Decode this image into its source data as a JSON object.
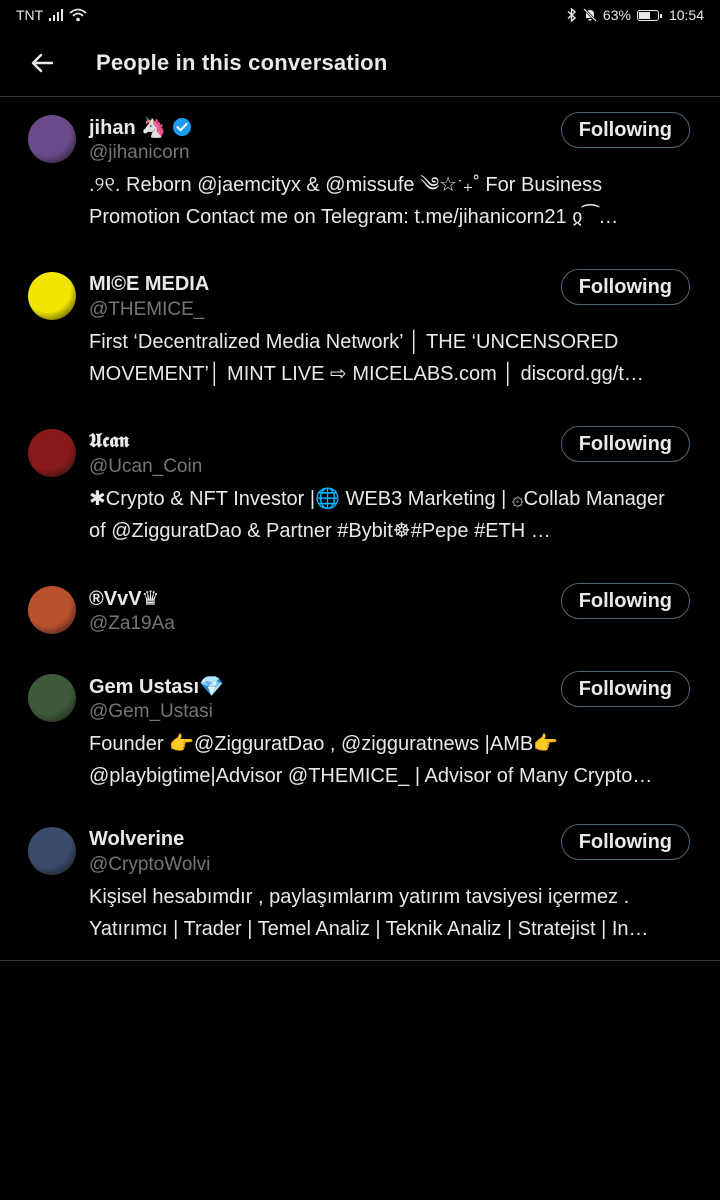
{
  "status_bar": {
    "carrier": "TNT",
    "battery": "63%",
    "battery_level": 0.63,
    "time": "10:54"
  },
  "header": {
    "title": "People in this conversation"
  },
  "people": [
    {
      "name": "jihan 🦄",
      "verified": true,
      "handle": "@jihanicorn",
      "bio": ".୨୧. Reborn @jaemcityx & @missufe ༄☆ˑ₊˚ For Business Promotion Contact me on Telegram: t.me/jihanicorn21 ჲ⁀…",
      "follow_label": "Following",
      "avatar_color": "#6b4a8a"
    },
    {
      "name": "MI©E MEDIA",
      "verified": false,
      "handle": "@THEMICE_",
      "bio": "First ‘Decentralized Media Network’ │ THE ‘UNCENSORED MOVEMENT’│ MINT LIVE ⇨ MICELABS.com │ discord.gg/t…",
      "follow_label": "Following",
      "avatar_color": "#f2e500"
    },
    {
      "name": "𝖀𝖈𝖆𝖓",
      "verified": false,
      "handle": "@Ucan_Coin",
      "bio": "✱Crypto & NFT Investor |🌐 WEB3 Marketing | ۞Collab Manager of @ZigguratDao & Partner #Bybit☸#Pepe #ETH …",
      "follow_label": "Following",
      "avatar_color": "#8a1a1a"
    },
    {
      "name": "®VvV♛",
      "verified": false,
      "handle": "@Za19Aa",
      "bio": "",
      "follow_label": "Following",
      "avatar_color": "#b8502e"
    },
    {
      "name": "Gem Ustası💎",
      "verified": false,
      "handle": "@Gem_Ustasi",
      "bio": "Founder 👉@ZigguratDao , @zigguratnews |AMB👉 @playbigtime|Advisor @THEMICE_ | Advisor of Many Crypto…",
      "follow_label": "Following",
      "avatar_color": "#3d5a3a"
    },
    {
      "name": "Wolverine",
      "verified": false,
      "handle": "@CryptoWolvi",
      "bio": "Kişisel hesabımdır , paylaşımlarım yatırım tavsiyesi içermez . Yatırımcı | Trader | Temel Analiz | Teknik Analiz | Stratejist | In…",
      "follow_label": "Following",
      "avatar_color": "#3a4a6a"
    }
  ]
}
